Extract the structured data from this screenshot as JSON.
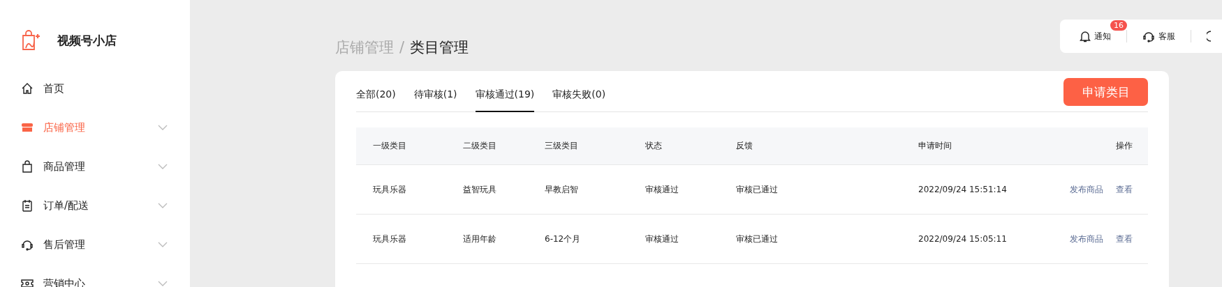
{
  "brand": {
    "name": "视频号小店"
  },
  "sidebar": {
    "items": [
      {
        "kind": "home",
        "label": "首页",
        "selected": false,
        "expandable": false
      },
      {
        "kind": "store",
        "label": "店铺管理",
        "selected": true,
        "expandable": true
      },
      {
        "kind": "bag",
        "label": "商品管理",
        "selected": false,
        "expandable": true
      },
      {
        "kind": "clipboard",
        "label": "订单/配送",
        "selected": false,
        "expandable": true
      },
      {
        "kind": "headset",
        "label": "售后管理",
        "selected": false,
        "expandable": true
      },
      {
        "kind": "ticket",
        "label": "营销中心",
        "selected": false,
        "expandable": true
      }
    ]
  },
  "breadcrumb": [
    "店铺管理",
    "类目管理"
  ],
  "breadcrumb_separator": "/",
  "top_actions": [
    {
      "kind": "bell",
      "label": "通知",
      "badge": "16"
    },
    {
      "kind": "headset",
      "label": "客服"
    }
  ],
  "tabs": [
    {
      "label": "全部(20)",
      "selected": false
    },
    {
      "label": "待审核(1)",
      "selected": false
    },
    {
      "label": "审核通过(19)",
      "selected": true
    },
    {
      "label": "审核失败(0)",
      "selected": false
    }
  ],
  "apply_button": "申请类目",
  "table": {
    "columns": [
      "一级类目",
      "二级类目",
      "三级类目",
      "状态",
      "反馈",
      "申请时间",
      "操作"
    ],
    "rows": [
      {
        "cells": [
          "玩具乐器",
          "益智玩具",
          "早教启智",
          "审核通过",
          "审核已通过",
          "2022/09/24 15:51:14"
        ],
        "actions": [
          "发布商品",
          "查看"
        ]
      },
      {
        "cells": [
          "玩具乐器",
          "适用年龄",
          "6-12个月",
          "审核通过",
          "审核已通过",
          "2022/09/24 15:05:11"
        ],
        "actions": [
          "发布商品",
          "查看"
        ]
      }
    ]
  }
}
